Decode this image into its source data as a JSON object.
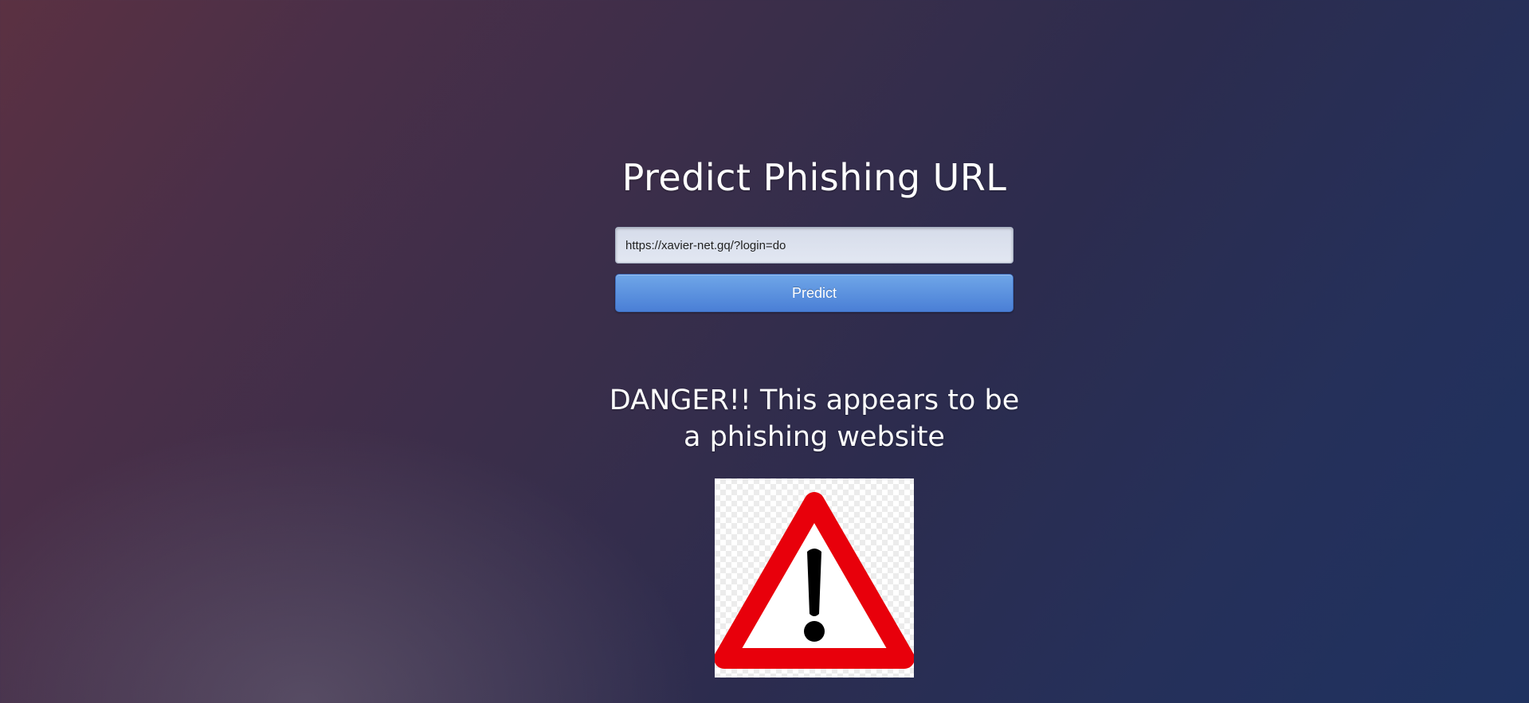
{
  "page": {
    "title": "Predict Phishing URL"
  },
  "form": {
    "url_value": "https://xavier-net.gq/?login=do",
    "predict_label": "Predict"
  },
  "result": {
    "message": "DANGER!! This appears to be a phishing website",
    "icon": "warning-triangle-icon",
    "colors": {
      "triangle": "#e8000b",
      "mark": "#000000"
    }
  }
}
